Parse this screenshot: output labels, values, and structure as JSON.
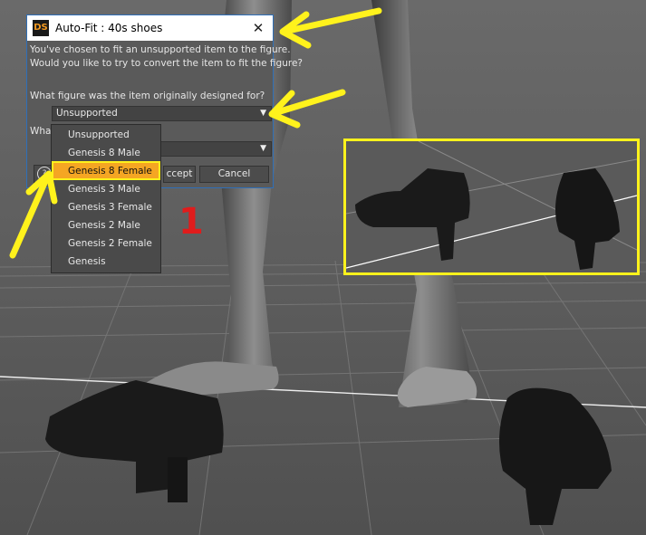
{
  "dialog": {
    "logo_text": "DS",
    "title": "Auto-Fit : 40s shoes",
    "close_glyph": "✕",
    "message_line1": "You've chosen to fit an unsupported item to the figure.",
    "message_line2": "Would you like to try to convert the item to fit the figure?",
    "question1": "What figure was the item originally designed for?",
    "question2_visible": "What",
    "figure_select": {
      "value": "Unsupported"
    },
    "second_select": {
      "value": ""
    },
    "help_glyph": "?",
    "accept_visible": "ccept",
    "cancel_label": "Cancel"
  },
  "dropdown": {
    "items": [
      "Unsupported",
      "Genesis 8 Male",
      "Genesis 8 Female",
      "Genesis 3 Male",
      "Genesis 3 Female",
      "Genesis 2 Male",
      "Genesis 2 Female",
      "Genesis"
    ],
    "highlighted": "Genesis 8 Female"
  },
  "annotation": {
    "step_number": "1",
    "highlight_color": "#fff21c",
    "number_color": "#e01c1c"
  },
  "icons": {
    "dialog_logo": "daz-studio-logo-icon",
    "close": "close-icon",
    "combo_arrow": "triangle-down-icon",
    "help": "help-icon"
  },
  "colors": {
    "dialog_border": "#2f6fb8",
    "selection": "#f5a623",
    "dialog_bg": "#5a5a5a",
    "scene_bg": "#5e5e5e"
  }
}
